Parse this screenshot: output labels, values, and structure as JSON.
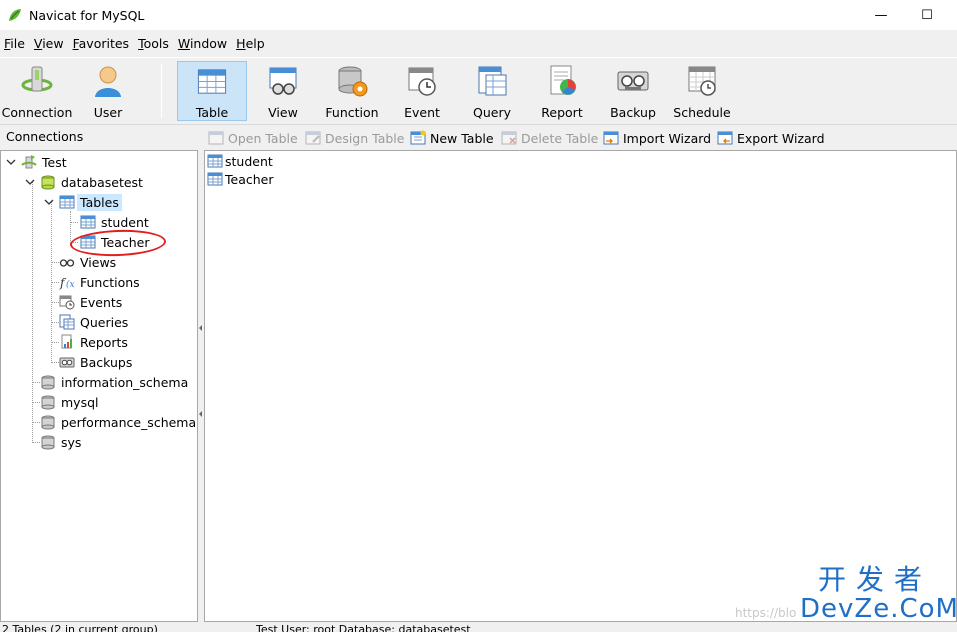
{
  "window": {
    "title": "Navicat for MySQL",
    "minimize_glyph": "—",
    "maximize_glyph": "☐"
  },
  "menu": [
    {
      "label": "File",
      "key": "F",
      "rest": "ile"
    },
    {
      "label": "View",
      "key": "V",
      "rest": "iew"
    },
    {
      "label": "Favorites",
      "key": "F",
      "rest": "avorites"
    },
    {
      "label": "Tools",
      "key": "T",
      "rest": "ools"
    },
    {
      "label": "Window",
      "key": "W",
      "rest": "indow"
    },
    {
      "label": "Help",
      "key": "H",
      "rest": "elp"
    }
  ],
  "toolbar": {
    "connection": "Connection",
    "user": "User",
    "table": "Table",
    "view": "View",
    "function": "Function",
    "event": "Event",
    "query": "Query",
    "report": "Report",
    "backup": "Backup",
    "schedule": "Schedule",
    "active": "Table"
  },
  "subbar": {
    "connections_label": "Connections",
    "open_table": "Open Table",
    "design_table": "Design Table",
    "new_table": "New Table",
    "delete_table": "Delete Table",
    "import_wizard": "Import Wizard",
    "export_wizard": "Export Wizard"
  },
  "tree": {
    "connection": "Test",
    "database": "databasetest",
    "tables_folder": "Tables",
    "tables": [
      "student",
      "Teacher"
    ],
    "views": "Views",
    "functions": "Functions",
    "events": "Events",
    "queries": "Queries",
    "reports": "Reports",
    "backups": "Backups",
    "other_databases": [
      "information_schema",
      "mysql",
      "performance_schema",
      "sys"
    ]
  },
  "objects": [
    "student",
    "Teacher"
  ],
  "status": {
    "left": "2 Tables (2 in current group)",
    "right": "Test  User: root  Database: databasetest"
  },
  "watermark": {
    "cn": "开发者",
    "en": "DevZe.CoM",
    "blog": "https://blo"
  },
  "colors": {
    "selection": "#cce4f7",
    "highlight_circle": "#e02020",
    "watermark": "#1f6fc7"
  }
}
